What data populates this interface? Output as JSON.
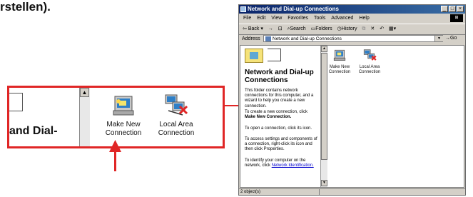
{
  "heading_fragment": "rstellen).",
  "zoom": {
    "title_fragment": "and Dial-",
    "icons": [
      {
        "name": "make-new-connection",
        "label_line1": "Make New",
        "label_line2": "Connection"
      },
      {
        "name": "local-area-connection",
        "label_line1": "Local Area",
        "label_line2": "Connection"
      }
    ]
  },
  "window": {
    "title": "Network and Dial-up Connections",
    "menu": [
      "File",
      "Edit",
      "View",
      "Favorites",
      "Tools",
      "Advanced",
      "Help"
    ],
    "toolbar": [
      "Back",
      "→",
      "Search",
      "Folders",
      "History"
    ],
    "address_label": "Address",
    "address_value": "Network and Dial-up Connections",
    "go_label": "Go",
    "left_title": "Network and Dial-up Connections",
    "paragraphs": [
      "This folder contains network connections for this computer, and a wizard to help you create a new connection.",
      "To create a new connection, click Make New Connection.",
      "To open a connection, click its icon.",
      "To access settings and components of a connection, right-click its icon and then click Properties.",
      "To identify your computer on the network, click"
    ],
    "para2_prefix": "To create a new connection, click",
    "para2_bold": "Make New Connection.",
    "para5_link": "Network Identification.",
    "icons": [
      {
        "label_line1": "Make New",
        "label_line2": "Connection"
      },
      {
        "label_line1": "Local Area",
        "label_line2": "Connection"
      }
    ],
    "status": "2 object(s)"
  },
  "colors": {
    "callout_red": "#e02626",
    "title_blue": "#0a246a"
  }
}
